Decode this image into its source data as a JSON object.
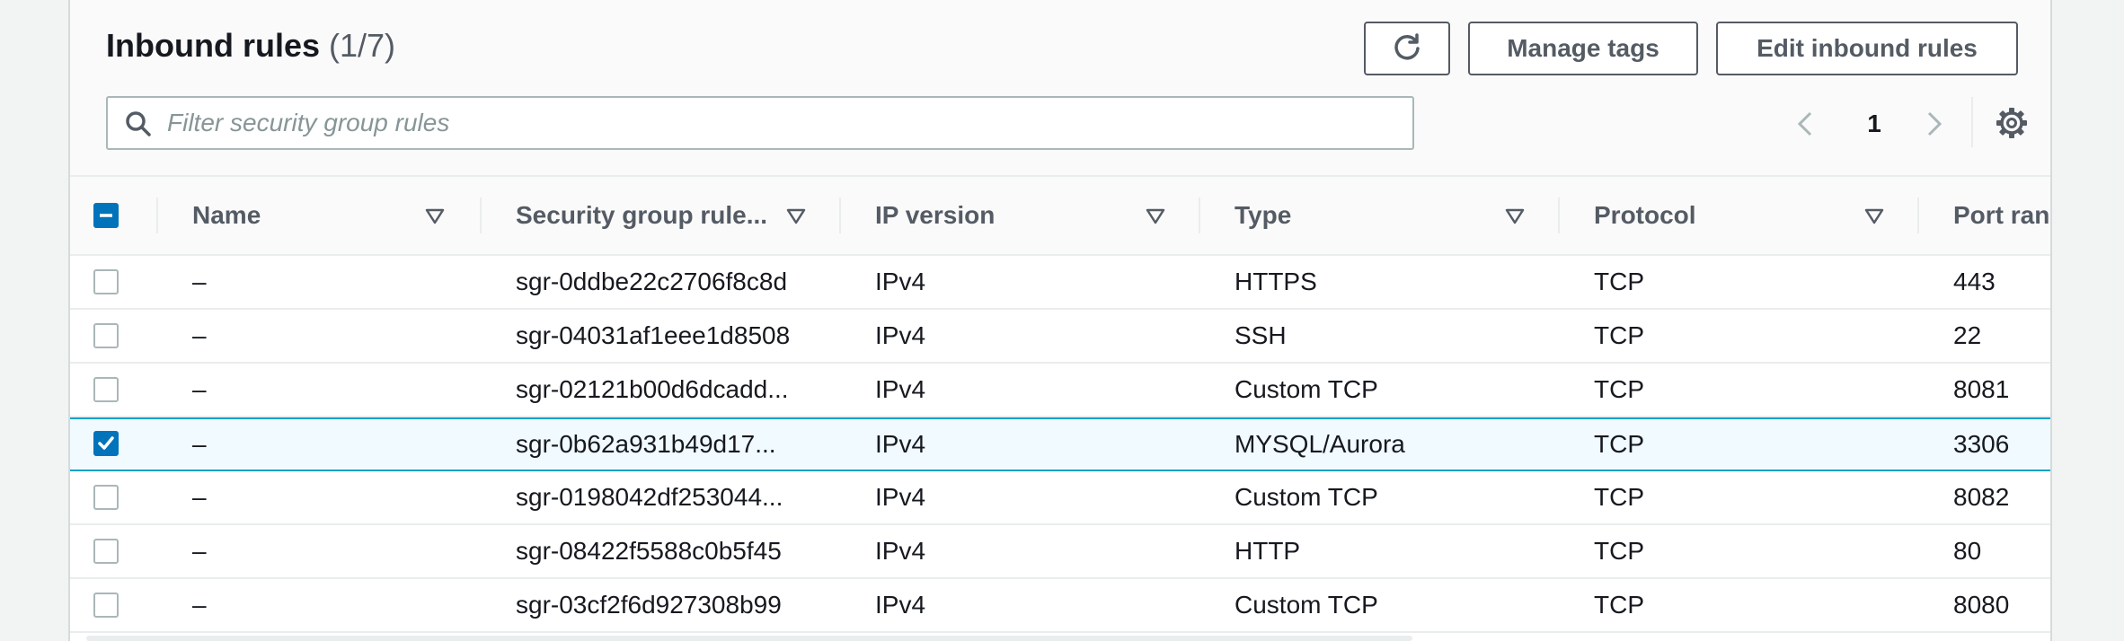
{
  "header": {
    "title": "Inbound rules",
    "count": "(1/7)",
    "refresh_icon": "refresh-icon",
    "manage_tags_label": "Manage tags",
    "edit_inbound_rules_label": "Edit inbound rules"
  },
  "search": {
    "icon": "search-icon",
    "placeholder": "Filter security group rules",
    "value": ""
  },
  "pagination": {
    "current_page": "1",
    "prev_icon": "chevron-left-icon",
    "next_icon": "chevron-right-icon",
    "settings_icon": "gear-icon"
  },
  "table": {
    "select_all_state": "indeterminate",
    "columns": [
      {
        "key": "name",
        "label": "Name"
      },
      {
        "key": "rule_id",
        "label": "Security group rule..."
      },
      {
        "key": "ip_version",
        "label": "IP version"
      },
      {
        "key": "type",
        "label": "Type"
      },
      {
        "key": "protocol",
        "label": "Protocol"
      },
      {
        "key": "port_range",
        "label": "Port ranc"
      }
    ],
    "rows": [
      {
        "selected": false,
        "name": "–",
        "rule_id": "sgr-0ddbe22c2706f8c8d",
        "ip_version": "IPv4",
        "type": "HTTPS",
        "protocol": "TCP",
        "port_range": "443"
      },
      {
        "selected": false,
        "name": "–",
        "rule_id": "sgr-04031af1eee1d8508",
        "ip_version": "IPv4",
        "type": "SSH",
        "protocol": "TCP",
        "port_range": "22"
      },
      {
        "selected": false,
        "name": "–",
        "rule_id": "sgr-02121b00d6dcadd...",
        "ip_version": "IPv4",
        "type": "Custom TCP",
        "protocol": "TCP",
        "port_range": "8081"
      },
      {
        "selected": true,
        "name": "–",
        "rule_id": "sgr-0b62a931b49d17...",
        "ip_version": "IPv4",
        "type": "MYSQL/Aurora",
        "protocol": "TCP",
        "port_range": "3306"
      },
      {
        "selected": false,
        "name": "–",
        "rule_id": "sgr-0198042df253044...",
        "ip_version": "IPv4",
        "type": "Custom TCP",
        "protocol": "TCP",
        "port_range": "8082"
      },
      {
        "selected": false,
        "name": "–",
        "rule_id": "sgr-08422f5588c0b5f45",
        "ip_version": "IPv4",
        "type": "HTTP",
        "protocol": "TCP",
        "port_range": "80"
      },
      {
        "selected": false,
        "name": "–",
        "rule_id": "sgr-03cf2f6d927308b99",
        "ip_version": "IPv4",
        "type": "Custom TCP",
        "protocol": "TCP",
        "port_range": "8080"
      }
    ]
  },
  "colors": {
    "accent": "#0073bb",
    "selected_border": "#00a1c9",
    "selected_bg": "#f1faff",
    "button_border": "#545b64"
  }
}
